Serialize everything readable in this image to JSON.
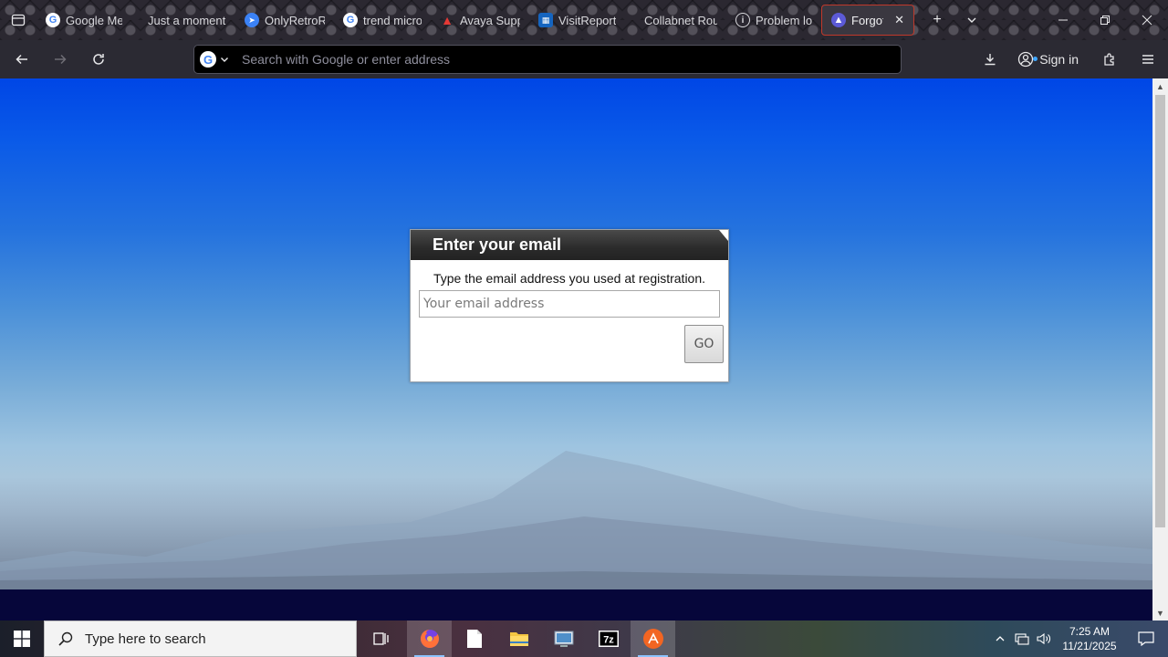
{
  "browser": {
    "tabs": [
      {
        "title": "Google Me",
        "favicon": "google-icon",
        "active": false
      },
      {
        "title": "Just a moment...",
        "favicon": "none",
        "active": false
      },
      {
        "title": "OnlyRetroR",
        "favicon": "telegram-icon",
        "active": false
      },
      {
        "title": "trend micro",
        "favicon": "google-icon",
        "active": false
      },
      {
        "title": "Avaya Supp",
        "favicon": "avaya-icon",
        "active": false
      },
      {
        "title": "VisitReport",
        "favicon": "app-icon",
        "active": false
      },
      {
        "title": "Collabnet Router",
        "favicon": "none",
        "active": false
      },
      {
        "title": "Problem lo",
        "favicon": "info-icon",
        "active": false
      },
      {
        "title": "Forgot p",
        "favicon": "site-icon",
        "active": true
      }
    ],
    "urlbar": {
      "placeholder": "Search with Google or enter address",
      "value": ""
    },
    "signin_label": "Sign in"
  },
  "page": {
    "dialog": {
      "title": "Enter your email",
      "instruction": "Type the email address you used at registration.",
      "email_placeholder": "Your email address",
      "email_value": "",
      "submit_label": "GO"
    }
  },
  "taskbar": {
    "search_placeholder": "Type here to search",
    "apps": [
      "task-view-icon",
      "firefox-icon",
      "notepad-icon",
      "file-explorer-icon",
      "control-panel-icon",
      "7zip-icon",
      "app-orange-icon"
    ],
    "time": "7:25 AM",
    "date": "11/21/2025"
  },
  "colors": {
    "sky_top": "#0046e6",
    "dialog_header": "#2b2b2b",
    "active_tab_border": "#c0392b"
  }
}
